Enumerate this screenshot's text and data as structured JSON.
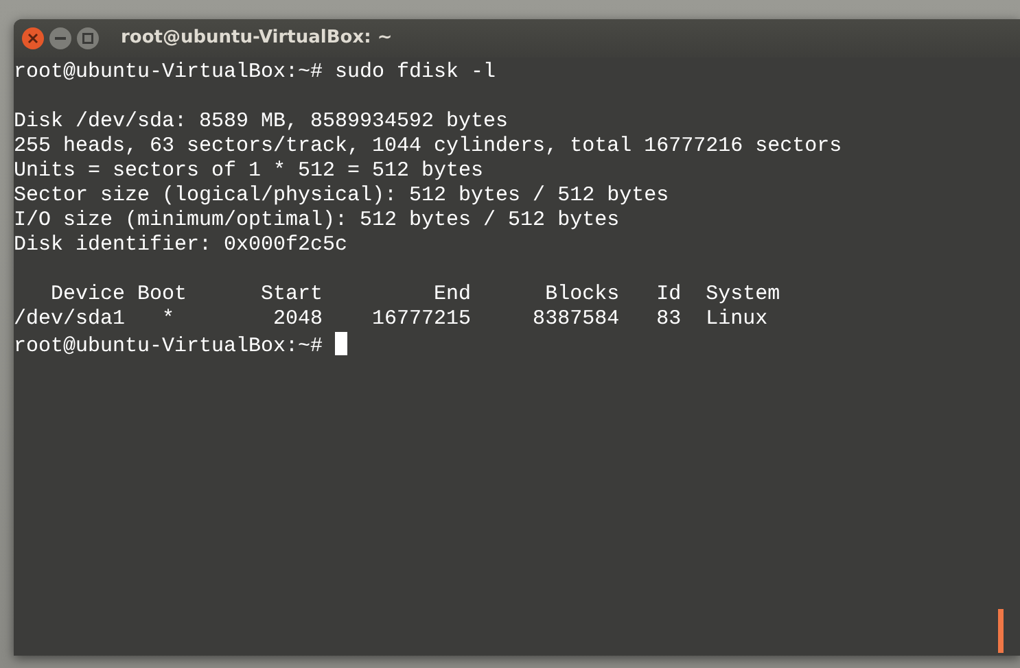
{
  "window": {
    "title": "root@ubuntu-VirtualBox: ~"
  },
  "terminal": {
    "lines": [
      {
        "kind": "prompt",
        "prompt": "root@ubuntu-VirtualBox:~#",
        "command": "sudo fdisk -l",
        "cursor": false
      },
      {
        "kind": "blank"
      },
      {
        "kind": "output",
        "text": "Disk /dev/sda: 8589 MB, 8589934592 bytes"
      },
      {
        "kind": "output",
        "text": "255 heads, 63 sectors/track, 1044 cylinders, total 16777216 sectors"
      },
      {
        "kind": "output",
        "text": "Units = sectors of 1 * 512 = 512 bytes"
      },
      {
        "kind": "output",
        "text": "Sector size (logical/physical): 512 bytes / 512 bytes"
      },
      {
        "kind": "output",
        "text": "I/O size (minimum/optimal): 512 bytes / 512 bytes"
      },
      {
        "kind": "output",
        "text": "Disk identifier: 0x000f2c5c"
      },
      {
        "kind": "blank"
      },
      {
        "kind": "output",
        "text": "   Device Boot      Start         End      Blocks   Id  System"
      },
      {
        "kind": "output",
        "text": "/dev/sda1   *        2048    16777215     8387584   83  Linux"
      },
      {
        "kind": "prompt",
        "prompt": "root@ubuntu-VirtualBox:~#",
        "cursor": true
      }
    ]
  }
}
